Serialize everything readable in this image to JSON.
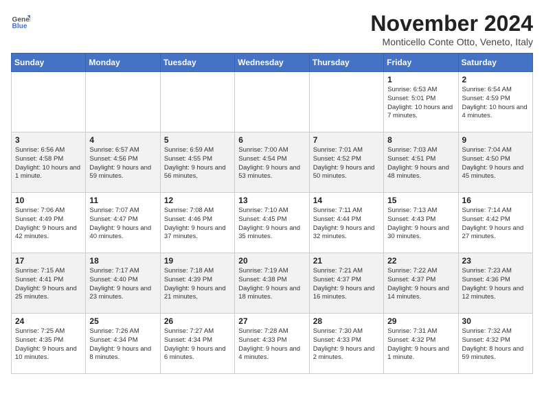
{
  "header": {
    "logo_line1": "General",
    "logo_line2": "Blue",
    "month": "November 2024",
    "location": "Monticello Conte Otto, Veneto, Italy"
  },
  "weekdays": [
    "Sunday",
    "Monday",
    "Tuesday",
    "Wednesday",
    "Thursday",
    "Friday",
    "Saturday"
  ],
  "weeks": [
    [
      {
        "day": "",
        "info": ""
      },
      {
        "day": "",
        "info": ""
      },
      {
        "day": "",
        "info": ""
      },
      {
        "day": "",
        "info": ""
      },
      {
        "day": "",
        "info": ""
      },
      {
        "day": "1",
        "info": "Sunrise: 6:53 AM\nSunset: 5:01 PM\nDaylight: 10 hours and 7 minutes."
      },
      {
        "day": "2",
        "info": "Sunrise: 6:54 AM\nSunset: 4:59 PM\nDaylight: 10 hours and 4 minutes."
      }
    ],
    [
      {
        "day": "3",
        "info": "Sunrise: 6:56 AM\nSunset: 4:58 PM\nDaylight: 10 hours and 1 minute."
      },
      {
        "day": "4",
        "info": "Sunrise: 6:57 AM\nSunset: 4:56 PM\nDaylight: 9 hours and 59 minutes."
      },
      {
        "day": "5",
        "info": "Sunrise: 6:59 AM\nSunset: 4:55 PM\nDaylight: 9 hours and 56 minutes."
      },
      {
        "day": "6",
        "info": "Sunrise: 7:00 AM\nSunset: 4:54 PM\nDaylight: 9 hours and 53 minutes."
      },
      {
        "day": "7",
        "info": "Sunrise: 7:01 AM\nSunset: 4:52 PM\nDaylight: 9 hours and 50 minutes."
      },
      {
        "day": "8",
        "info": "Sunrise: 7:03 AM\nSunset: 4:51 PM\nDaylight: 9 hours and 48 minutes."
      },
      {
        "day": "9",
        "info": "Sunrise: 7:04 AM\nSunset: 4:50 PM\nDaylight: 9 hours and 45 minutes."
      }
    ],
    [
      {
        "day": "10",
        "info": "Sunrise: 7:06 AM\nSunset: 4:49 PM\nDaylight: 9 hours and 42 minutes."
      },
      {
        "day": "11",
        "info": "Sunrise: 7:07 AM\nSunset: 4:47 PM\nDaylight: 9 hours and 40 minutes."
      },
      {
        "day": "12",
        "info": "Sunrise: 7:08 AM\nSunset: 4:46 PM\nDaylight: 9 hours and 37 minutes."
      },
      {
        "day": "13",
        "info": "Sunrise: 7:10 AM\nSunset: 4:45 PM\nDaylight: 9 hours and 35 minutes."
      },
      {
        "day": "14",
        "info": "Sunrise: 7:11 AM\nSunset: 4:44 PM\nDaylight: 9 hours and 32 minutes."
      },
      {
        "day": "15",
        "info": "Sunrise: 7:13 AM\nSunset: 4:43 PM\nDaylight: 9 hours and 30 minutes."
      },
      {
        "day": "16",
        "info": "Sunrise: 7:14 AM\nSunset: 4:42 PM\nDaylight: 9 hours and 27 minutes."
      }
    ],
    [
      {
        "day": "17",
        "info": "Sunrise: 7:15 AM\nSunset: 4:41 PM\nDaylight: 9 hours and 25 minutes."
      },
      {
        "day": "18",
        "info": "Sunrise: 7:17 AM\nSunset: 4:40 PM\nDaylight: 9 hours and 23 minutes."
      },
      {
        "day": "19",
        "info": "Sunrise: 7:18 AM\nSunset: 4:39 PM\nDaylight: 9 hours and 21 minutes."
      },
      {
        "day": "20",
        "info": "Sunrise: 7:19 AM\nSunset: 4:38 PM\nDaylight: 9 hours and 18 minutes."
      },
      {
        "day": "21",
        "info": "Sunrise: 7:21 AM\nSunset: 4:37 PM\nDaylight: 9 hours and 16 minutes."
      },
      {
        "day": "22",
        "info": "Sunrise: 7:22 AM\nSunset: 4:37 PM\nDaylight: 9 hours and 14 minutes."
      },
      {
        "day": "23",
        "info": "Sunrise: 7:23 AM\nSunset: 4:36 PM\nDaylight: 9 hours and 12 minutes."
      }
    ],
    [
      {
        "day": "24",
        "info": "Sunrise: 7:25 AM\nSunset: 4:35 PM\nDaylight: 9 hours and 10 minutes."
      },
      {
        "day": "25",
        "info": "Sunrise: 7:26 AM\nSunset: 4:34 PM\nDaylight: 9 hours and 8 minutes."
      },
      {
        "day": "26",
        "info": "Sunrise: 7:27 AM\nSunset: 4:34 PM\nDaylight: 9 hours and 6 minutes."
      },
      {
        "day": "27",
        "info": "Sunrise: 7:28 AM\nSunset: 4:33 PM\nDaylight: 9 hours and 4 minutes."
      },
      {
        "day": "28",
        "info": "Sunrise: 7:30 AM\nSunset: 4:33 PM\nDaylight: 9 hours and 2 minutes."
      },
      {
        "day": "29",
        "info": "Sunrise: 7:31 AM\nSunset: 4:32 PM\nDaylight: 9 hours and 1 minute."
      },
      {
        "day": "30",
        "info": "Sunrise: 7:32 AM\nSunset: 4:32 PM\nDaylight: 8 hours and 59 minutes."
      }
    ]
  ]
}
